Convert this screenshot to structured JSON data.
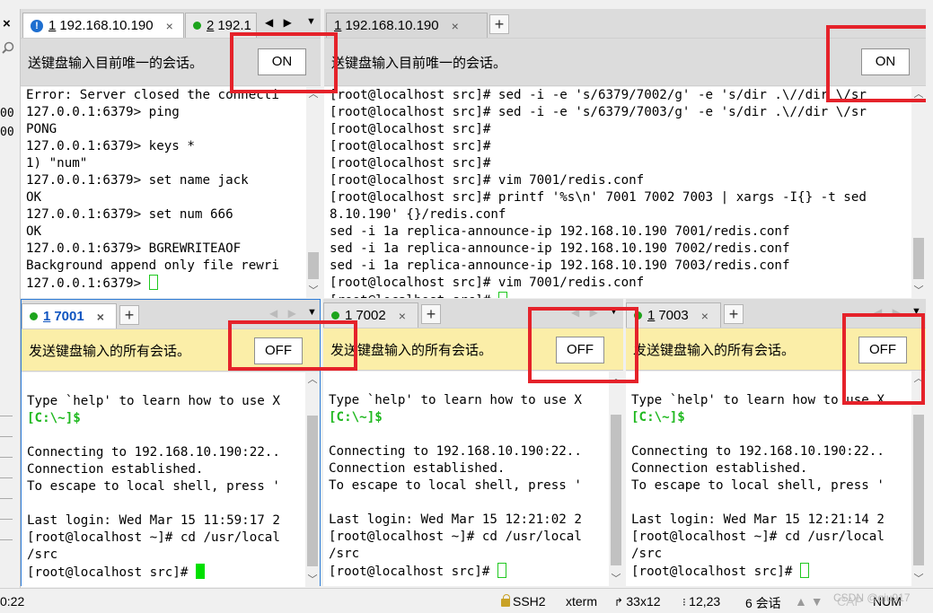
{
  "left_strip": {
    "close_glyph": "×",
    "fragments": [
      "00",
      "00",
      "0:22"
    ]
  },
  "top_left": {
    "tabs": [
      {
        "num": "1",
        "label": "192.168.10.190",
        "status": "warn",
        "status_glyph": "!",
        "close": "×"
      },
      {
        "num": "2",
        "label": "192.1",
        "status": "connected"
      }
    ],
    "banner_text": "送键盘输入目前唯一的会话。",
    "toggle": "ON",
    "lines": [
      "Error: Server closed the connecti",
      "127.0.0.1:6379> ping",
      "PONG",
      "127.0.0.1:6379> keys *",
      "1) \"num\"",
      "127.0.0.1:6379> set name jack",
      "OK",
      "127.0.0.1:6379> set num 666",
      "OK",
      "127.0.0.1:6379> BGREWRITEAOF",
      "Background append only file rewri",
      "127.0.0.1:6379> "
    ]
  },
  "top_right": {
    "tabs": [
      {
        "num": "1",
        "label": "192.168.10.190",
        "close": "×"
      }
    ],
    "new_tab": "+",
    "banner_text": "送键盘输入目前唯一的会话。",
    "toggle": "ON",
    "lines": [
      "[root@localhost src]# sed -i -e 's/6379/7002/g' -e 's/dir .\\//dir \\/sr",
      "[root@localhost src]# sed -i -e 's/6379/7003/g' -e 's/dir .\\//dir \\/sr",
      "[root@localhost src]#",
      "[root@localhost src]#",
      "[root@localhost src]#",
      "[root@localhost src]# vim 7001/redis.conf",
      "[root@localhost src]# printf '%s\\n' 7001 7002 7003 | xargs -I{} -t sed",
      "8.10.190' {}/redis.conf",
      "sed -i 1a replica-announce-ip 192.168.10.190 7001/redis.conf",
      "sed -i 1a replica-announce-ip 192.168.10.190 7002/redis.conf",
      "sed -i 1a replica-announce-ip 192.168.10.190 7003/redis.conf",
      "[root@localhost src]# vim 7001/redis.conf",
      "[root@localhost src]# "
    ]
  },
  "bottom_panes": [
    {
      "tab_num": "1",
      "tab_label": "7001",
      "close": "×",
      "new_tab": "+",
      "banner_text": "发送键盘输入的所有会话。",
      "toggle": "OFF",
      "prompt_color": "[C:\\~]$",
      "lines": [
        "",
        "Type `help' to learn how to use X",
        "",
        "",
        "Connecting to 192.168.10.190:22..",
        "Connection established.",
        "To escape to local shell, press '",
        "",
        "Last login: Wed Mar 15 11:59:17 2",
        "[root@localhost ~]# cd /usr/local",
        "/src",
        "[root@localhost src]# "
      ]
    },
    {
      "tab_num": "1",
      "tab_label": "7002",
      "close": "×",
      "new_tab": "+",
      "banner_text": "发送键盘输入的所有会话。",
      "toggle": "OFF",
      "prompt_color": "[C:\\~]$",
      "lines": [
        "",
        "Type `help' to learn how to use X",
        "",
        "",
        "Connecting to 192.168.10.190:22..",
        "Connection established.",
        "To escape to local shell, press '",
        "",
        "Last login: Wed Mar 15 12:21:02 2",
        "[root@localhost ~]# cd /usr/local",
        "/src",
        "[root@localhost src]# "
      ]
    },
    {
      "tab_num": "1",
      "tab_label": "7003",
      "close": "×",
      "new_tab": "+",
      "banner_text": "发送键盘输入的所有会话。",
      "toggle": "OFF",
      "prompt_color": "[C:\\~]$",
      "lines": [
        "",
        "Type `help' to learn how to use X",
        "",
        "",
        "Connecting to 192.168.10.190:22..",
        "Connection established.",
        "To escape to local shell, press '",
        "",
        "Last login: Wed Mar 15 12:21:14 2",
        "[root@localhost ~]# cd /usr/local",
        "/src",
        "[root@localhost src]# "
      ]
    }
  ],
  "status_bar": {
    "time": "0:22",
    "protocol": "SSH2",
    "terminal": "xterm",
    "size": "33x12",
    "position": "12,23",
    "sessions": "6 会话",
    "caps": "CAP",
    "num": "NUM",
    "watermark": "CSDN @qiu917"
  },
  "colors": {
    "highlight_box": "#e5222a",
    "banner_on": "#dcdcdc",
    "banner_off": "#fbeea8",
    "connected_dot": "#1ca41c",
    "prompt_green": "#1fb81f",
    "active_tab_blue": "#1055c0"
  }
}
